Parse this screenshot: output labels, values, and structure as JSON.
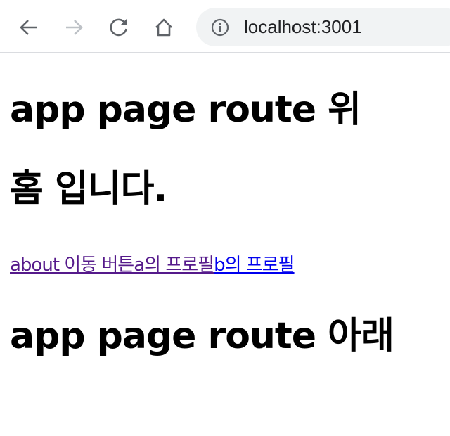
{
  "browser": {
    "url": "localhost:3001",
    "icons": {
      "back": "arrow-left-icon",
      "forward": "arrow-right-icon",
      "reload": "reload-icon",
      "home": "home-icon",
      "site_info": "info-icon"
    }
  },
  "page": {
    "heading_top": "app page route 위",
    "heading_home": "홈 입니다.",
    "links": [
      {
        "label": "about 이동 버튼",
        "visited": true
      },
      {
        "label": "a의 프로필",
        "visited": true
      },
      {
        "label": "b의 프로필",
        "visited": false
      }
    ],
    "heading_bottom": "app page route 아래"
  },
  "colors": {
    "visited_link": "#551a8b",
    "link": "#0000ee",
    "toolbar_icon": "#5f6368",
    "toolbar_icon_disabled": "#bdc1c6",
    "omnibox_bg": "#f1f3f4"
  }
}
